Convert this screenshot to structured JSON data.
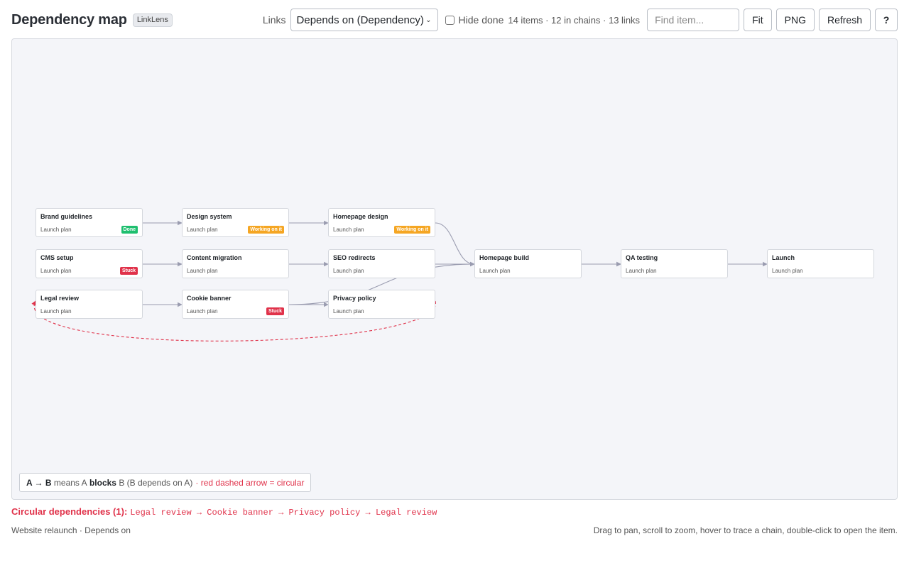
{
  "header": {
    "title": "Dependency map",
    "app_badge": "LinkLens",
    "links_label": "Links",
    "links_select_value": "Depends on (Dependency)",
    "hide_done_label": "Hide done",
    "hide_done_checked": false,
    "stats": "14 items · 12 in chains · 13 links",
    "search_placeholder": "Find item...",
    "fit_label": "Fit",
    "png_label": "PNG",
    "refresh_label": "Refresh",
    "help_label": "?"
  },
  "colors": {
    "done": "#1fbf6f",
    "working": "#f5a623",
    "stuck": "#e0324a",
    "edge": "#9a9cb0",
    "circular_edge": "#e0324a"
  },
  "nodes": [
    {
      "id": "brand",
      "title": "Brand guidelines",
      "board": "Launch plan",
      "status": "Done",
      "status_kind": "done",
      "col": 0,
      "row": 0
    },
    {
      "id": "cms",
      "title": "CMS setup",
      "board": "Launch plan",
      "status": "Stuck",
      "status_kind": "stuck",
      "col": 0,
      "row": 1
    },
    {
      "id": "legal",
      "title": "Legal review",
      "board": "Launch plan",
      "status": "",
      "status_kind": "",
      "col": 0,
      "row": 2
    },
    {
      "id": "design",
      "title": "Design system",
      "board": "Launch plan",
      "status": "Working on it",
      "status_kind": "working",
      "col": 1,
      "row": 0
    },
    {
      "id": "content",
      "title": "Content migration",
      "board": "Launch plan",
      "status": "",
      "status_kind": "",
      "col": 1,
      "row": 1
    },
    {
      "id": "cookie",
      "title": "Cookie banner",
      "board": "Launch plan",
      "status": "Stuck",
      "status_kind": "stuck",
      "col": 1,
      "row": 2
    },
    {
      "id": "hpdesign",
      "title": "Homepage design",
      "board": "Launch plan",
      "status": "Working on it",
      "status_kind": "working",
      "col": 2,
      "row": 0
    },
    {
      "id": "seo",
      "title": "SEO redirects",
      "board": "Launch plan",
      "status": "",
      "status_kind": "",
      "col": 2,
      "row": 1
    },
    {
      "id": "privacy",
      "title": "Privacy policy",
      "board": "Launch plan",
      "status": "",
      "status_kind": "",
      "col": 2,
      "row": 2
    },
    {
      "id": "hpbuild",
      "title": "Homepage build",
      "board": "Launch plan",
      "status": "",
      "status_kind": "",
      "col": 3,
      "row": 1
    },
    {
      "id": "qa",
      "title": "QA testing",
      "board": "Launch plan",
      "status": "",
      "status_kind": "",
      "col": 4,
      "row": 1
    },
    {
      "id": "launch",
      "title": "Launch",
      "board": "Launch plan",
      "status": "",
      "status_kind": "",
      "col": 5,
      "row": 1
    }
  ],
  "edges": [
    {
      "from": "brand",
      "to": "design",
      "circular": false
    },
    {
      "from": "design",
      "to": "hpdesign",
      "circular": false
    },
    {
      "from": "hpdesign",
      "to": "hpbuild",
      "circular": false
    },
    {
      "from": "cms",
      "to": "content",
      "circular": false
    },
    {
      "from": "cms",
      "to": "qa",
      "circular": false
    },
    {
      "from": "content",
      "to": "seo",
      "circular": false
    },
    {
      "from": "seo",
      "to": "qa",
      "circular": false
    },
    {
      "from": "hpbuild",
      "to": "qa",
      "circular": false
    },
    {
      "from": "qa",
      "to": "launch",
      "circular": false
    },
    {
      "from": "legal",
      "to": "cookie",
      "circular": false
    },
    {
      "from": "cookie",
      "to": "privacy",
      "circular": false
    },
    {
      "from": "cookie",
      "to": "hpbuild",
      "circular": false
    },
    {
      "from": "privacy",
      "to": "legal",
      "circular": true
    }
  ],
  "legend": {
    "a_to_b": "A → B",
    "means": "means A",
    "blocks": "blocks",
    "b_depends": "B (B depends on A)",
    "circular_note": "· red dashed arrow = circular"
  },
  "circular": {
    "label": "Circular dependencies (1):",
    "path": "Legal review → Cookie banner → Privacy policy → Legal review"
  },
  "footer": {
    "left": "Website relaunch · Depends on",
    "right": "Drag to pan, scroll to zoom, hover to trace a chain, double-click to open the item."
  }
}
